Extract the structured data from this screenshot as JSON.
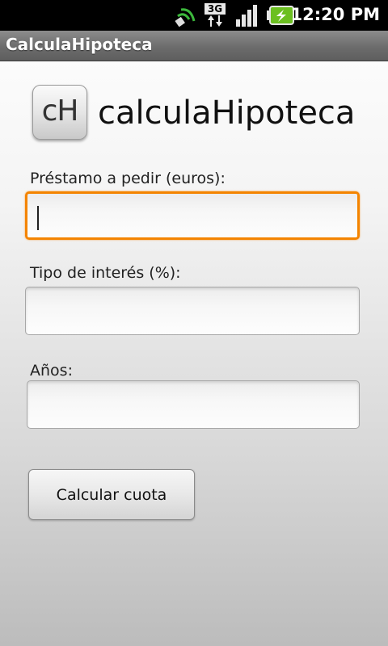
{
  "status_bar": {
    "time": "12:20 PM",
    "network_type": "3G",
    "icons": [
      "gps-satellite-icon",
      "3g-data-icon",
      "signal-strength-icon",
      "battery-charging-icon"
    ]
  },
  "title_bar": {
    "title": "CalculaHipoteca"
  },
  "app_header": {
    "logo_text": "cH",
    "title": "calculaHipoteca"
  },
  "form": {
    "loan": {
      "label": "Préstamo a pedir (euros):",
      "value": "",
      "focused": true
    },
    "interest": {
      "label": "Tipo de interés (%):",
      "value": ""
    },
    "years": {
      "label": "Años:",
      "value": ""
    },
    "submit_label": "Calcular cuota"
  },
  "colors": {
    "focus_border": "#f48400",
    "battery_green": "#6bbf20",
    "gps_green": "#3cb83c"
  }
}
